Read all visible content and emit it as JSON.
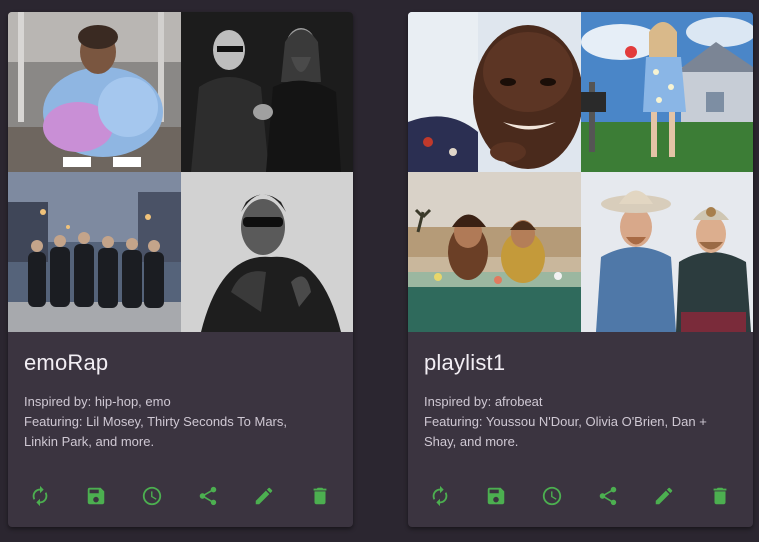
{
  "theme": {
    "accent": "#4caf50",
    "card_bg": "#3b3440",
    "page_bg": "#2b2630"
  },
  "playlists": [
    {
      "title": "emoRap",
      "inspired": "Inspired by: hip-hop, emo",
      "featuring_line1": "Featuring: Lil Mosey, Thirty Seconds To Mars,",
      "featuring_line2": "Linkin Park, and more.",
      "images": [
        "artist-photo-lil-mosey",
        "artist-photo-thirty-seconds-to-mars",
        "artist-photo-linkin-park",
        "artist-photo-future"
      ]
    },
    {
      "title": "playlist1",
      "inspired": "Inspired by: afrobeat",
      "featuring_line1": "Featuring: Youssou N'Dour, Olivia O'Brien, Dan +",
      "featuring_line2": "Shay, and more.",
      "images": [
        "artist-photo-youssou-ndour",
        "artist-photo-olivia-obrien",
        "artist-photo-dan-shay",
        "artist-photo-florida-georgia-line"
      ]
    }
  ],
  "actions": [
    "refresh-icon",
    "save-icon",
    "clock-icon",
    "share-icon",
    "edit-icon",
    "delete-icon"
  ]
}
